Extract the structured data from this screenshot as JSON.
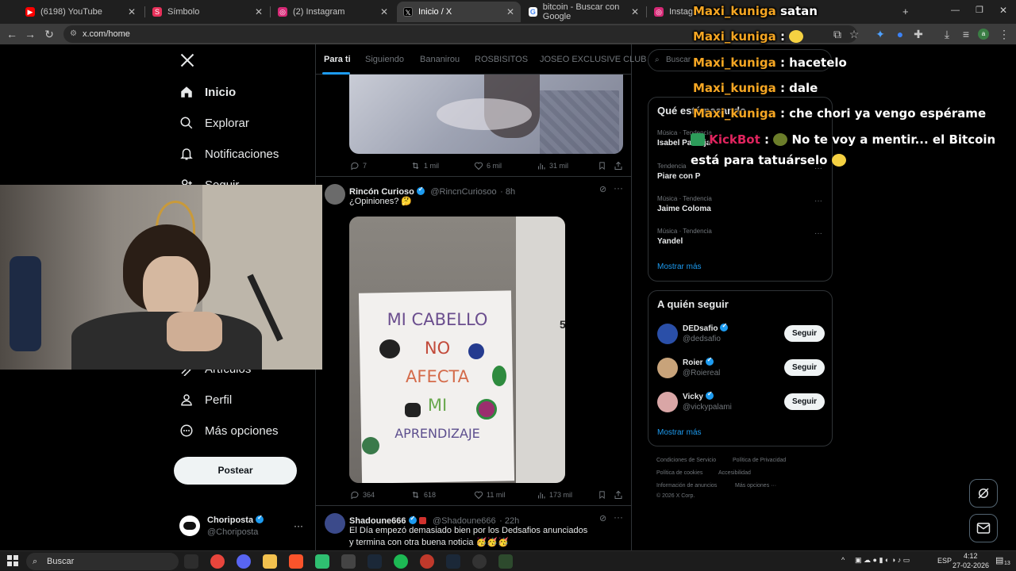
{
  "browser": {
    "tabs": [
      {
        "title": "(6198) YouTube",
        "favicon_color": "#ff0000"
      },
      {
        "title": "Símbolo",
        "favicon_color": "#e8305a"
      },
      {
        "title": "(2) Instagram",
        "favicon_color": "#d62976"
      },
      {
        "title": "Inicio / X",
        "favicon_color": "#000000",
        "active": true
      },
      {
        "title": "bitcoin - Buscar con Google",
        "favicon_color": "#4285f4"
      },
      {
        "title": "Instagram",
        "favicon_color": "#d62976"
      }
    ],
    "new_tab_symbol": "+",
    "url": "x.com/home"
  },
  "x": {
    "logo": "X",
    "nav": {
      "home": "Inicio",
      "explore": "Explorar",
      "notifications": "Notificaciones",
      "follow": "Seguir",
      "articles": "Artículos",
      "profile": "Perfil",
      "more": "Más opciones"
    },
    "post_button": "Postear",
    "account": {
      "name": "Choriposta",
      "handle": "@Choriposta"
    },
    "feed_tabs": [
      "Para ti",
      "Siguiendo",
      "Bananirou",
      "ROSBISITOS",
      "JOSEO EXCLUSIVE CLUB"
    ],
    "tweet0_stats": {
      "replies": "7",
      "reposts": "1 mil",
      "likes": "6 mil",
      "views": "31 mil"
    },
    "tweet1": {
      "name": "Rincón Curioso",
      "handle": "@RincnCuriosoo",
      "time": "· 8h",
      "text": "¿Opiniones? 🤔",
      "sign_lines": [
        "MI CABELLO",
        "NO",
        "AFECTA",
        "MI",
        "APRENDIZAJE"
      ],
      "door_number": "5",
      "stats": {
        "replies": "364",
        "reposts": "618",
        "likes": "11 mil",
        "views": "173 mil"
      }
    },
    "tweet2": {
      "name": "Shadoune666",
      "handle": "@Shadoune666",
      "time": "· 22h",
      "text_line1": "El Día empezó demasiado bien por los Dedsafios anunciados",
      "text_line2": "y termina con otra buena noticia 🥳🥳🥳"
    },
    "search_placeholder": "Buscar",
    "trends": {
      "title": "Qué está pasando",
      "items": [
        {
          "meta": "Música · Tendencia",
          "name": "Isabel Pantoja"
        },
        {
          "meta": "Tendencia",
          "name": "Piare con P"
        },
        {
          "meta": "Música · Tendencia",
          "name": "Jaime Coloma"
        },
        {
          "meta": "Música · Tendencia",
          "name": "Yandel"
        }
      ],
      "more": "···",
      "show_more": "Mostrar más"
    },
    "who_to_follow": {
      "title": "A quién seguir",
      "items": [
        {
          "name": "DEDsafio",
          "handle": "@dedsafio",
          "button": "Seguir"
        },
        {
          "name": "Roier",
          "handle": "@Roiereal",
          "button": "Seguir"
        },
        {
          "name": "Vicky",
          "handle": "@vickypalami",
          "button": "Seguir"
        }
      ],
      "show_more": "Mostrar más"
    },
    "footer": {
      "terms": "Condiciones de Servicio",
      "privacy": "Política de Privacidad",
      "cookies": "Política de cookies",
      "accessibility": "Accesibilidad",
      "ads": "Información de anuncios",
      "more": "Más opciones ···",
      "copyright": "© 2026 X Corp."
    }
  },
  "chat": [
    {
      "user": "Maxi_kuniga",
      "text": "satan"
    },
    {
      "user": "Maxi_kuniga",
      "text": ":"
    },
    {
      "user": "Maxi_kuniga",
      "text": ": hacetelo"
    },
    {
      "user": "Maxi_kuniga",
      "text": ": dale"
    },
    {
      "user": "Maxi_kuniga",
      "text": ": che chori ya vengo espérame"
    },
    {
      "user": "KickBot",
      "sep": ":",
      "text_line1": "No te voy a mentir... el Bitcoin",
      "text_line2": "está para tatuárselo"
    }
  ],
  "taskbar": {
    "search": "Buscar",
    "lang": "ESP",
    "time": "4:12",
    "date": "27-02-2026",
    "notif_count": "13"
  }
}
